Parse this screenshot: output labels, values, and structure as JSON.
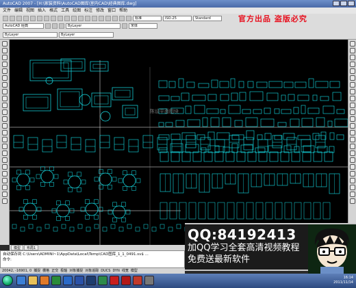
{
  "window": {
    "title": "AutoCAD 2007 - [H:\\家装资料\\AutoCAD图库\\室内CAD\\经典图库.dwg]"
  },
  "menu": [
    "文件",
    "编辑",
    "视图",
    "插入",
    "格式",
    "工具",
    "绘图",
    "标注",
    "修改",
    "窗口",
    "帮助"
  ],
  "toolbar": {
    "workspace_label": "AutoCAD 经典",
    "layer_combo": "ByLayer",
    "textstyle_combo": "标准",
    "dimstyle_combo": "ISO-25",
    "tablestyle_combo": "Standard",
    "font_combo": "宋体",
    "color_combo": "ByLayer",
    "lineweight_combo": "ByLayer"
  },
  "banner": {
    "text": "官方出品 盗版必究",
    "color": "#e8101e"
  },
  "canvas": {
    "label": "陈设平面图块",
    "colors": {
      "line": "#17e6ef",
      "text": "#9aa0a6",
      "accent_white": "#ffffff"
    }
  },
  "layout_tabs": [
    "模型",
    "布局1"
  ],
  "command": {
    "line1": "自动保存到 C:\\Users\\ADMINI~1\\AppData\\Local\\Temp\\CAD图库_1_1_0491.sv$ ...",
    "line2": "命令:"
  },
  "status": {
    "coordinates": "20042, -16901, 0",
    "buttons": [
      "捕捉",
      "栅格",
      "正交",
      "极轴",
      "对象捕捉",
      "对象追踪",
      "DUCS",
      "DYN",
      "线宽",
      "模型"
    ]
  },
  "promo": {
    "qq": "QQ:84192413",
    "line1": "加QQ学习全套高清视频教程",
    "line2": "免费送最新软件"
  },
  "taskbar": {
    "time": "16:14",
    "date": "2011/11/14"
  }
}
